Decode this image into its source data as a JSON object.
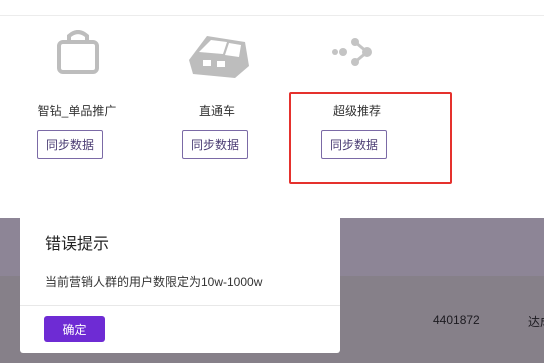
{
  "channels": [
    {
      "icon": "shopping-bag-icon",
      "label": "智钻_单品推广",
      "button": "同步数据"
    },
    {
      "icon": "train-icon",
      "label": "直通车",
      "button": "同步数据"
    },
    {
      "icon": "share-arrow-icon",
      "label": "超级推荐",
      "button": "同步数据"
    }
  ],
  "background_table": {
    "cell_1": "4401872",
    "cell_2": "达成"
  },
  "dialog": {
    "title": "错误提示",
    "message": "当前营销人群的用户数限定为10w-1000w",
    "ok_label": "确定"
  },
  "colors": {
    "accent": "#6e2bd4",
    "highlight": "#e5312d"
  }
}
